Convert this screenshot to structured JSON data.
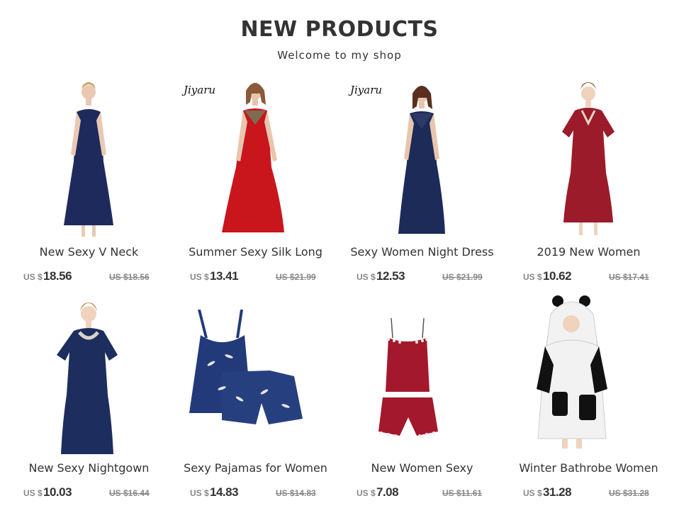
{
  "header": {
    "title": "NEW PRODUCTS",
    "subtitle": "Welcome to my shop"
  },
  "products": [
    {
      "name": "New Sexy V Neck",
      "currency": "US $",
      "price": "18.56",
      "old_price": "US $18.56",
      "brand": "",
      "color": "#1f2a5c",
      "image": "navy satin slip nightgown"
    },
    {
      "name": "Summer Sexy Silk Long",
      "currency": "US $",
      "price": "13.41",
      "old_price": "US $21.99",
      "brand": "Jiyaru",
      "color": "#c8161c",
      "image": "red silk slip nightgown"
    },
    {
      "name": "Sexy Women Night Dress",
      "currency": "US $",
      "price": "12.53",
      "old_price": "US $21.99",
      "brand": "Jiyaru",
      "color": "#1c2b58",
      "image": "navy lace night dress"
    },
    {
      "name": "2019 New Women",
      "currency": "US $",
      "price": "10.62",
      "old_price": "US $17.41",
      "brand": "",
      "color": "#9b1b2b",
      "image": "burgundy short sleeve nightgown"
    },
    {
      "name": "New Sexy Nightgown",
      "currency": "US $",
      "price": "10.03",
      "old_price": "US $16.44",
      "brand": "",
      "color": "#1d2d5e",
      "image": "navy short sleeve nightgown"
    },
    {
      "name": "Sexy Pajamas for Women",
      "currency": "US $",
      "price": "14.83",
      "old_price": "US $14.83",
      "brand": "",
      "color": "#223a7a",
      "image": "navy printed cami pajama set"
    },
    {
      "name": "New Women Sexy",
      "currency": "US $",
      "price": "7.08",
      "old_price": "US $11.61",
      "brand": "",
      "color": "#a3182c",
      "image": "red cami and shorts set"
    },
    {
      "name": "Winter Bathrobe Women",
      "currency": "US $",
      "price": "31.28",
      "old_price": "US $31.28",
      "brand": "",
      "color": "#f2f2f2",
      "image": "panda hooded bathrobe"
    }
  ]
}
